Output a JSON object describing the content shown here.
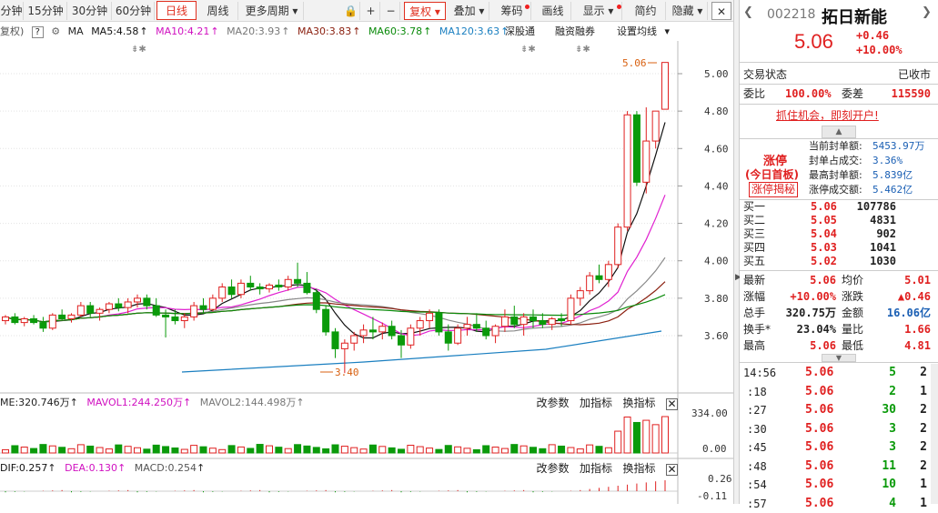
{
  "toolbar": {
    "periods": [
      "分钟",
      "15分钟",
      "30分钟",
      "60分钟",
      "日线",
      "周线",
      "更多周期"
    ],
    "active_period": "日线",
    "plus": "+",
    "minus": "−",
    "restore_label": "复权",
    "overlay_label": "叠加",
    "chips_label": "筹码",
    "line_label": "画线",
    "display_label": "显示",
    "simplify_label": "简约",
    "hide_label": "隐藏"
  },
  "indicator_bar": {
    "restore": "复权)",
    "ma_label": "MA",
    "ma5": "MA5:4.58",
    "ma10": "MA10:4.21",
    "ma20": "MA20:3.93",
    "ma30": "MA30:3.83",
    "ma60": "MA60:3.78",
    "ma120": "MA120:3.63",
    "sh_link": "深股通",
    "margin": "融资融券",
    "setma": "设置均线"
  },
  "price_axis": {
    "ticks": [
      "5.00",
      "4.80",
      "4.60",
      "4.40",
      "4.20",
      "4.00",
      "3.80",
      "3.60"
    ]
  },
  "annotations": {
    "high": "5.06",
    "low": "3.40"
  },
  "volume_panel": {
    "vol": "ME:320.746万",
    "mavol1": "MAVOL1:244.250万",
    "mavol2": "MAVOL2:144.498万",
    "axis_top": "334.00",
    "axis_bottom": "0.00",
    "links": [
      "改参数",
      "加指标",
      "换指标"
    ]
  },
  "macd_panel": {
    "dif": "DIF:0.257",
    "dea": "DEA:0.130",
    "macd": "MACD:0.254",
    "axis_top": "0.26",
    "axis_bottom": "-0.11",
    "links": [
      "改参数",
      "加指标",
      "换指标"
    ]
  },
  "stock": {
    "code": "002218",
    "name": "拓日新能",
    "price": "5.06",
    "change": "+0.46",
    "change_pct": "+10.00%"
  },
  "status": {
    "label": "交易状态",
    "value": "已收市"
  },
  "commission": {
    "ratio_label": "委比",
    "ratio": "100.00%",
    "diff_label": "委差",
    "diff": "115590"
  },
  "promo": "抓住机会，即刻开户!",
  "limit_up": {
    "title": "涨停",
    "sub": "(今日首板)",
    "button": "涨停揭秘",
    "items": [
      {
        "label": "当前封单额:",
        "value": "5453.97万"
      },
      {
        "label": "封单占成交:",
        "value": "3.36%"
      },
      {
        "label": "最高封单额:",
        "value": "5.839亿"
      },
      {
        "label": "涨停成交额:",
        "value": "5.462亿"
      }
    ]
  },
  "bids": [
    {
      "label": "买一",
      "price": "5.06",
      "vol": "107786"
    },
    {
      "label": "买二",
      "price": "5.05",
      "vol": "4831"
    },
    {
      "label": "买三",
      "price": "5.04",
      "vol": "902"
    },
    {
      "label": "买四",
      "price": "5.03",
      "vol": "1041"
    },
    {
      "label": "买五",
      "price": "5.02",
      "vol": "1030"
    }
  ],
  "stats": [
    {
      "l1": "最新",
      "v1": "5.06",
      "l2": "均价",
      "v2": "5.01"
    },
    {
      "l1": "涨幅",
      "v1": "+10.00%",
      "l2": "涨跌",
      "v2": "▲0.46"
    },
    {
      "l1": "总手",
      "v1": "320.75万",
      "l2": "金额",
      "v2": "16.06亿"
    },
    {
      "l1": "换手*",
      "v1": "23.04%",
      "l2": "量比",
      "v2": "1.66"
    },
    {
      "l1": "最高",
      "v1": "5.06",
      "l2": "最低",
      "v2": "4.81"
    }
  ],
  "ticks": [
    {
      "time": "14:56",
      "price": "5.06",
      "vol": "5",
      "n": "2"
    },
    {
      "time": ":18",
      "price": "5.06",
      "vol": "2",
      "n": "1"
    },
    {
      "time": ":27",
      "price": "5.06",
      "vol": "30",
      "n": "2"
    },
    {
      "time": ":30",
      "price": "5.06",
      "vol": "3",
      "n": "2"
    },
    {
      "time": ":45",
      "price": "5.06",
      "vol": "3",
      "n": "2"
    },
    {
      "time": ":48",
      "price": "5.06",
      "vol": "11",
      "n": "2"
    },
    {
      "time": ":54",
      "price": "5.06",
      "vol": "10",
      "n": "1"
    },
    {
      "time": ":57",
      "price": "5.06",
      "vol": "4",
      "n": "1"
    }
  ],
  "colors": {
    "up": "#e02020",
    "down": "#0a9a0a",
    "ma5": "#111111",
    "ma10": "#e020d0",
    "ma20": "#888888",
    "ma30": "#8b2010",
    "ma60": "#0a8a0a",
    "ma120": "#1a7fc0"
  }
}
